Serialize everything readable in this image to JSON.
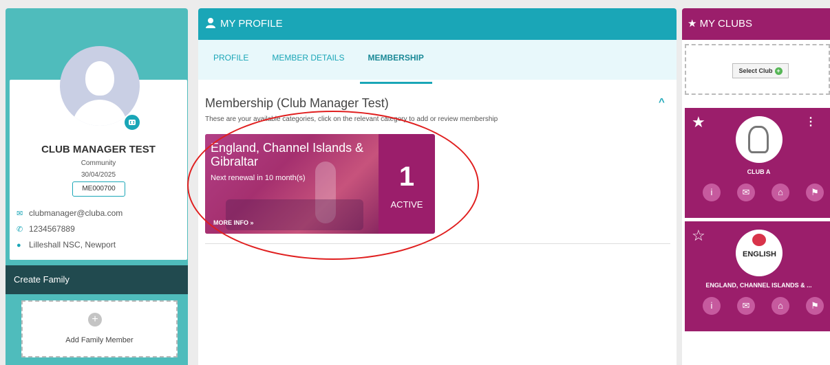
{
  "left": {
    "name": "CLUB MANAGER TEST",
    "type": "Community",
    "date": "30/04/2025",
    "member_id": "ME000700",
    "email": "clubmanager@cluba.com",
    "phone": "1234567889",
    "address": "Lilleshall NSC, Newport",
    "create_family": "Create Family",
    "add_family": "Add Family Member",
    "add_icon": "+"
  },
  "main": {
    "header": "MY PROFILE",
    "tabs": [
      {
        "label": "PROFILE"
      },
      {
        "label": "MEMBER DETAILS"
      },
      {
        "label": "MEMBERSHIP"
      }
    ],
    "title": "Membership (Club Manager Test)",
    "subtitle": "These are your available categories, click on the relevant category to add or review membership",
    "collapse_icon": "^",
    "membership": {
      "name": "England, Channel Islands & Gibraltar",
      "renewal": "Next renewal in 10 month(s)",
      "more_info": "MORE INFO »",
      "count": "1",
      "status": "ACTIVE"
    }
  },
  "right": {
    "header": "MY CLUBS",
    "select_club": "Select Club",
    "select_icon": "+",
    "clubs": [
      {
        "name": "CLUB A",
        "star": "★",
        "menu": "⋮",
        "logo_text": ""
      },
      {
        "name": "ENGLAND, CHANNEL ISLANDS & ...",
        "star": "☆",
        "logo_text": "ENGLISH"
      }
    ],
    "icons": [
      "i",
      "✉",
      "⌂",
      "⚑"
    ]
  },
  "colors": {
    "teal": "#1aa6b7",
    "magenta": "#9b1e6b",
    "dark_teal": "#214a4f"
  }
}
